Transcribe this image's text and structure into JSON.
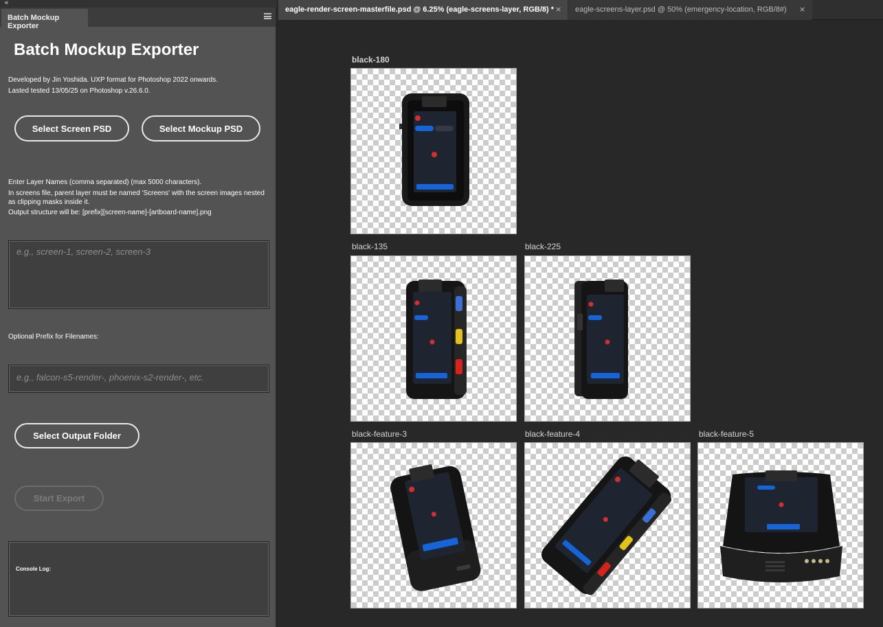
{
  "panel": {
    "collapse_glyph": "«",
    "tab_label": "Batch Mockup Exporter",
    "title": "Batch Mockup Exporter",
    "intro_line1": "Developed by Jin Yoshida. UXP format for Photoshop 2022 onwards.",
    "intro_line2": "Lasted tested 13/05/25 on Photoshop v.26.6.0.",
    "select_screen_label": "Select Screen PSD",
    "select_mockup_label": "Select Mockup PSD",
    "layer_info_line1": "Enter Layer Names (comma separated) (max 5000 characters).",
    "layer_info_line2": "In screens file, parent layer must be named 'Screens' with the screen images nested as clipping masks inside it.",
    "layer_info_line3": "Output structure will be: [prefix][screen-name]-[artboard-name].png",
    "layer_names_placeholder": "e.g., screen-1, screen-2, screen-3",
    "prefix_label": "Optional Prefix for Filenames:",
    "prefix_placeholder": "e.g., falcon-s5-render-, phoenix-s2-render-, etc.",
    "output_folder_label": "Select Output Folder",
    "start_export_label": "Start Export",
    "console_label": "Console Log:"
  },
  "doc_tabs": [
    {
      "title": "eagle-render-screen-masterfile.psd @ 6.25% (eagle-screens-layer, RGB/8) *",
      "close": "×",
      "active": true
    },
    {
      "title": "eagle-screens-layer.psd @ 50% (emergency-location, RGB/8#)",
      "close": "×",
      "active": false
    }
  ],
  "artboards": [
    {
      "name": "black-180"
    },
    {
      "name": "black-135"
    },
    {
      "name": "black-225"
    },
    {
      "name": "black-feature-3"
    },
    {
      "name": "black-feature-4"
    },
    {
      "name": "black-feature-5"
    }
  ],
  "colors": {
    "panel_bg": "#535353",
    "canvas_bg": "#282828",
    "device_body": "#1a1a1a",
    "screen_accent": "#1565d8",
    "button_blue": "#3b6fd6",
    "button_yellow": "#e3c21a",
    "button_red": "#d6231c"
  }
}
